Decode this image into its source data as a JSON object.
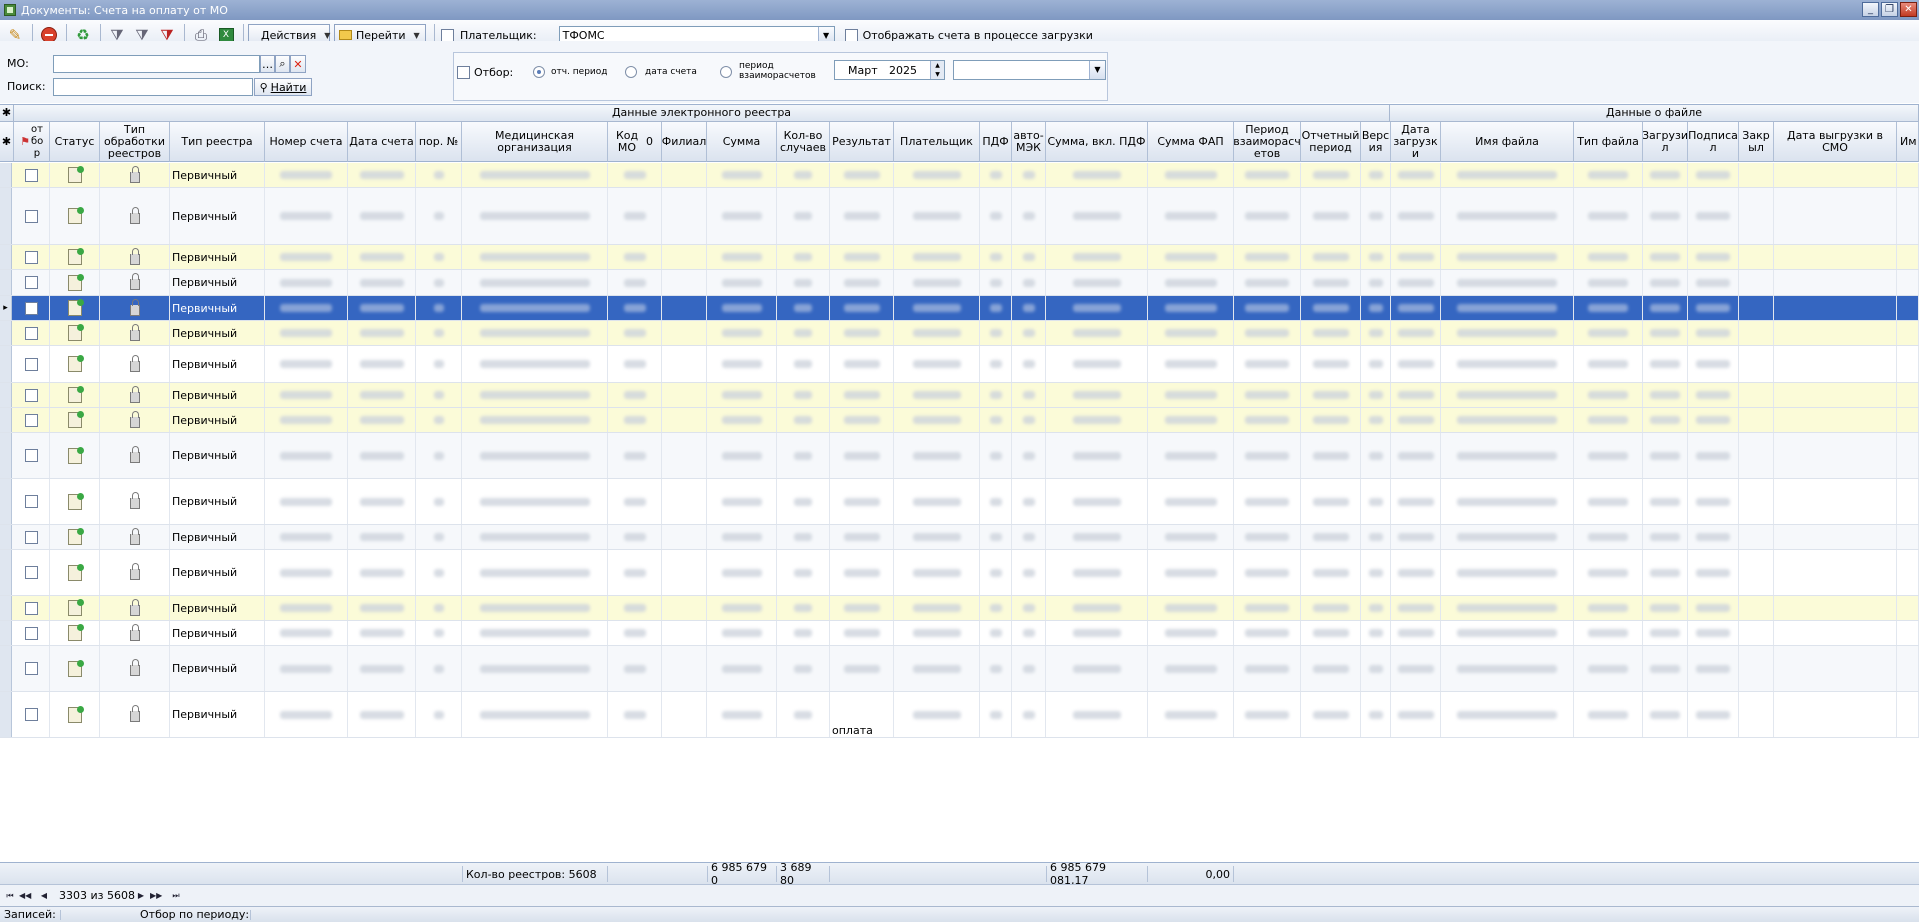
{
  "window": {
    "title": "Документы: Счета на оплату от МО"
  },
  "toolbar": {
    "actions_label": "Действия",
    "goto_label": "Перейти",
    "payer_label": "Плательщик:",
    "payer_value": "ТФОМС",
    "show_loading_label": "Отображать счета в процессе загрузки"
  },
  "filter": {
    "mo_label": "МО:",
    "search_label": "Поиск:",
    "find_label": "Найти",
    "otbor_label": "Отбор:",
    "radio_period": "отч. период",
    "radio_date": "дата счета",
    "radio_mutual": "период взаиморасчетов",
    "month": "Март",
    "year": "2025"
  },
  "grid": {
    "band_registry": "Данные электронного реестра",
    "band_file": "Данные о файле",
    "columns": {
      "otbor": "от бо р",
      "status": "Статус",
      "proc_type": "Тип обработки реестров",
      "reg_type": "Тип реестра",
      "acc_no": "Номер счета",
      "acc_date": "Дата счета",
      "ord_no": "пор. №",
      "med_org": "Медицинская организация",
      "mo_code": "Код МО",
      "mo_code_sort": "0",
      "branch": "Филиал",
      "sum": "Сумма",
      "cases": "Кол-во случаев",
      "result": "Результат",
      "payer": "Плательщик",
      "pdf": "ПДФ",
      "auto_mek": "авто-МЭК",
      "sum_pdf": "Сумма, вкл. ПДФ",
      "sum_fap": "Сумма ФАП",
      "period_mutual": "Период взаиморасч етов",
      "report_period": "Отчетный период",
      "version": "Верс ия",
      "load_date": "Дата загрузк и",
      "file_name": "Имя файла",
      "file_type": "Тип файла",
      "loaded": "Загрузи л",
      "signed": "Подписа л",
      "closed": "Закр ыл",
      "smo_date": "Дата выгрузки в СМО",
      "extra": "Им"
    },
    "rows": [
      {
        "reg_type": "Первичный",
        "style": "yellow"
      },
      {
        "reg_type": "Первичный",
        "style": "alt"
      },
      {
        "reg_type": "Первичный",
        "style": "yellow"
      },
      {
        "reg_type": "Первичный",
        "style": "alt"
      },
      {
        "reg_type": "Первичный",
        "style": "sel"
      },
      {
        "reg_type": "Первичный",
        "style": "yellow"
      },
      {
        "reg_type": "Первичный",
        "style": "white"
      },
      {
        "reg_type": "Первичный",
        "style": "yellow"
      },
      {
        "reg_type": "Первичный",
        "style": "yellow"
      },
      {
        "reg_type": "Первичный",
        "style": "alt"
      },
      {
        "reg_type": "Первичный",
        "style": "white"
      },
      {
        "reg_type": "Первичный",
        "style": "alt"
      },
      {
        "reg_type": "Первичный",
        "style": "white"
      },
      {
        "reg_type": "Первичный",
        "style": "yellow"
      },
      {
        "reg_type": "Первичный",
        "style": "white"
      },
      {
        "reg_type": "Первичный",
        "style": "alt"
      },
      {
        "reg_type": "Первичный",
        "style": "white",
        "result_visible": "оплата"
      }
    ]
  },
  "footer": {
    "count_label": "Кол-во реестров: 5608",
    "sum_total": "6 985 679 0",
    "cases_total": "3 689 80",
    "sum_pdf_total": "6 985 679 081,17",
    "sum_fap_total": "0,00"
  },
  "nav": {
    "position": "3303 из 5608"
  },
  "statusbar": {
    "records_label": "Записей:",
    "period_label": "Отбор по периоду:"
  }
}
